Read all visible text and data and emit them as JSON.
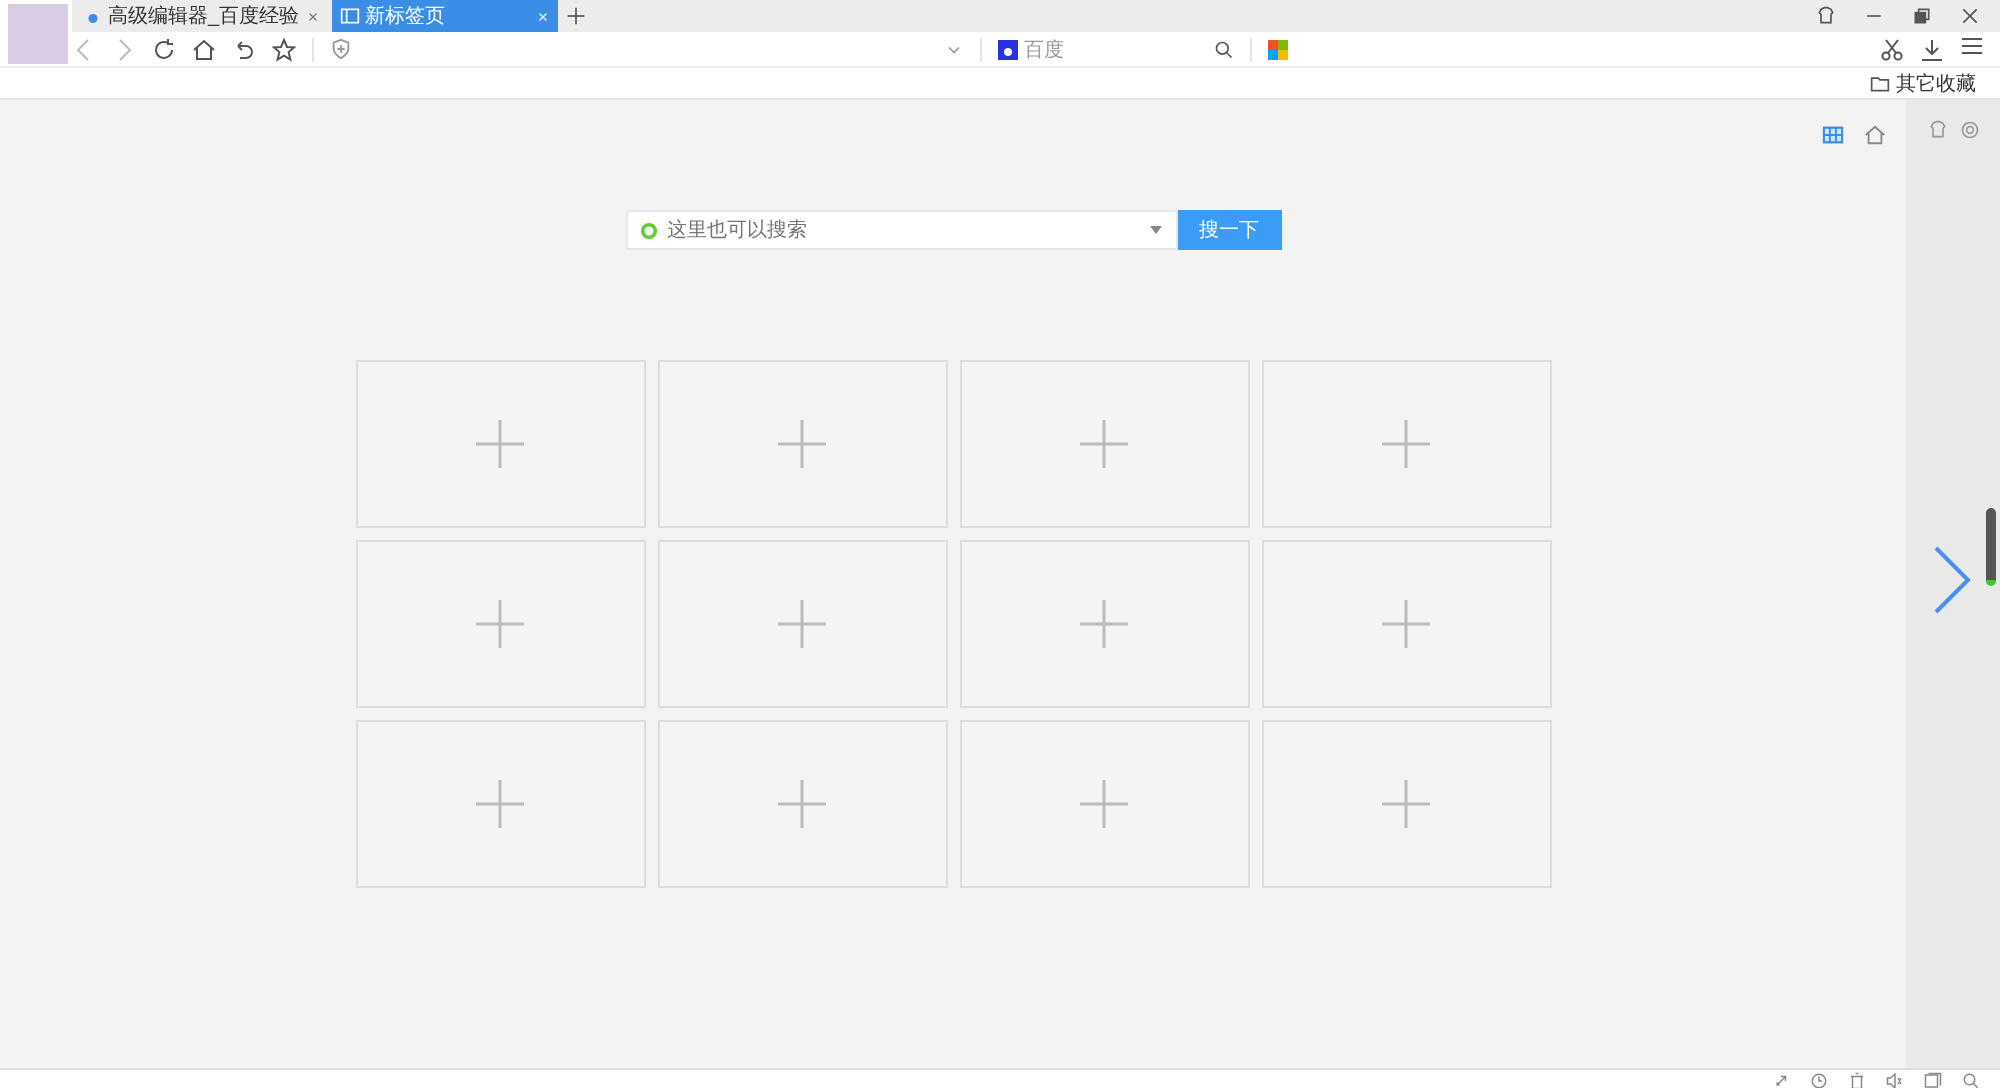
{
  "tabs": [
    {
      "label": "高级编辑器_百度经验",
      "selected": false
    },
    {
      "label": "新标签页",
      "selected": true
    }
  ],
  "toolbar": {
    "search_engine": "百度"
  },
  "bookmarks_bar": {
    "folder": "其它收藏"
  },
  "search": {
    "placeholder": "这里也可以搜索",
    "button": "搜一下"
  },
  "tiles": [
    {
      "kind": "add"
    },
    {
      "kind": "add"
    },
    {
      "kind": "add"
    },
    {
      "kind": "add"
    },
    {
      "kind": "add"
    },
    {
      "kind": "add"
    },
    {
      "kind": "add"
    },
    {
      "kind": "add"
    },
    {
      "kind": "add"
    },
    {
      "kind": "add"
    },
    {
      "kind": "add"
    },
    {
      "kind": "add"
    }
  ]
}
